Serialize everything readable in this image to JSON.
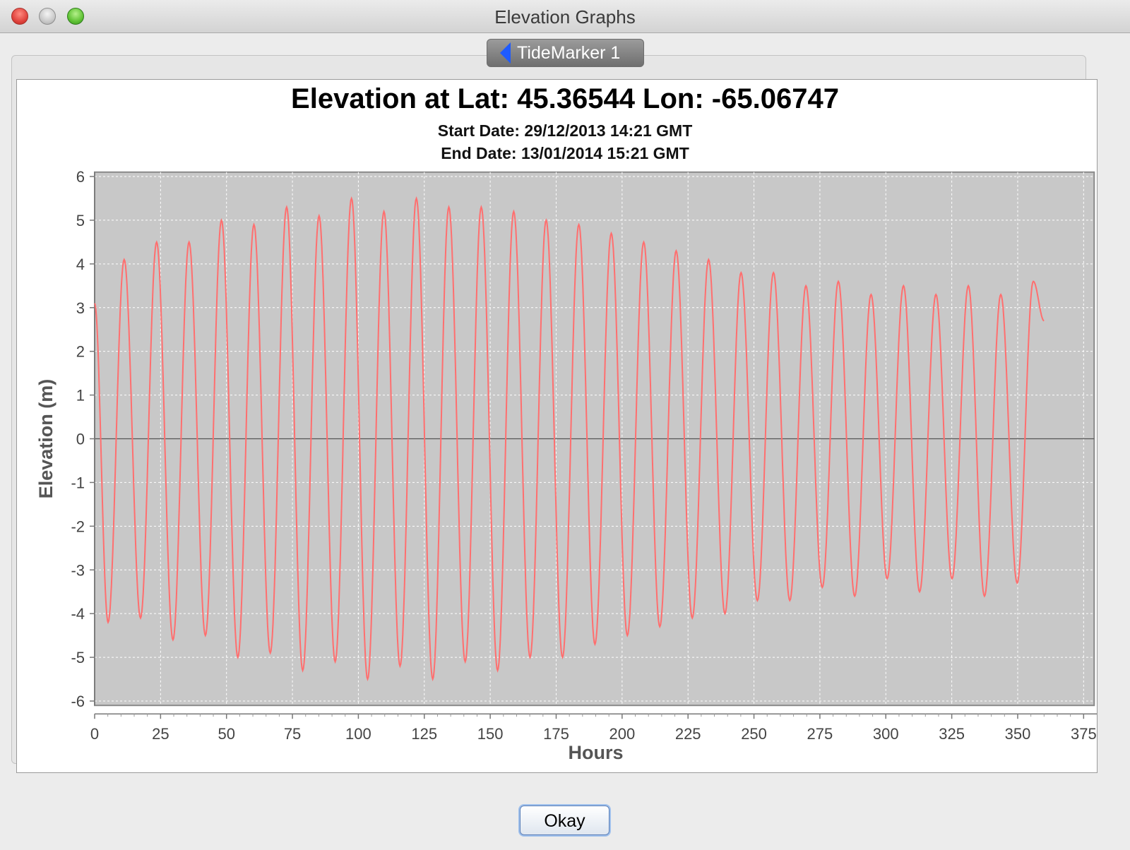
{
  "window": {
    "title": "Elevation Graphs"
  },
  "tab": {
    "label": "TideMarker 1",
    "icon": "left-arrow-icon"
  },
  "chart_data": {
    "type": "line",
    "title": "Elevation at Lat: 45.36544 Lon: -65.06747",
    "subtitle": [
      "Start Date: 29/12/2013 14:21 GMT",
      "End Date: 13/01/2014 15:21 GMT"
    ],
    "xlabel": "Hours",
    "ylabel": "Elevation (m)",
    "xlim": [
      0,
      380
    ],
    "ylim": [
      -6,
      6
    ],
    "xticks": [
      0,
      25,
      50,
      75,
      100,
      125,
      150,
      175,
      200,
      225,
      250,
      275,
      300,
      325,
      350,
      375
    ],
    "yticks": [
      -6,
      -5,
      -4,
      -3,
      -2,
      -1,
      0,
      1,
      2,
      3,
      4,
      5,
      6
    ],
    "grid": true,
    "background": "#c8c8c8",
    "series": [
      {
        "color": "#ff6f6f",
        "x": [
          0,
          5.1,
          11.2,
          17.4,
          23.5,
          29.7,
          35.8,
          42.0,
          48.1,
          54.3,
          60.4,
          66.6,
          72.8,
          78.9,
          85.1,
          91.2,
          97.4,
          103.5,
          109.7,
          115.8,
          122.0,
          128.2,
          134.3,
          140.5,
          146.6,
          152.8,
          158.9,
          165.1,
          171.2,
          177.4,
          183.6,
          189.7,
          195.9,
          202.0,
          208.2,
          214.3,
          220.5,
          226.6,
          232.8,
          239.0,
          245.1,
          251.3,
          257.4,
          263.6,
          269.7,
          275.9,
          282.0,
          288.2,
          294.4,
          300.5,
          306.7,
          312.8,
          319.0,
          325.1,
          331.3,
          337.4,
          343.6,
          349.8,
          355.9,
          360
        ],
        "y": [
          3.1,
          -4.2,
          4.1,
          -4.1,
          4.5,
          -4.6,
          4.5,
          -4.5,
          5.0,
          -5.0,
          4.9,
          -4.9,
          5.3,
          -5.3,
          5.1,
          -5.1,
          5.5,
          -5.5,
          5.2,
          -5.2,
          5.5,
          -5.5,
          5.3,
          -5.1,
          5.3,
          -5.3,
          5.2,
          -5.0,
          5.0,
          -5.0,
          4.9,
          -4.7,
          4.7,
          -4.5,
          4.5,
          -4.3,
          4.3,
          -4.1,
          4.1,
          -4.0,
          3.8,
          -3.7,
          3.8,
          -3.7,
          3.5,
          -3.4,
          3.6,
          -3.6,
          3.3,
          -3.2,
          3.5,
          -3.5,
          3.3,
          -3.2,
          3.5,
          -3.6,
          3.3,
          -3.3,
          3.6,
          2.7
        ]
      }
    ]
  },
  "buttons": {
    "okay_label": "Okay"
  }
}
